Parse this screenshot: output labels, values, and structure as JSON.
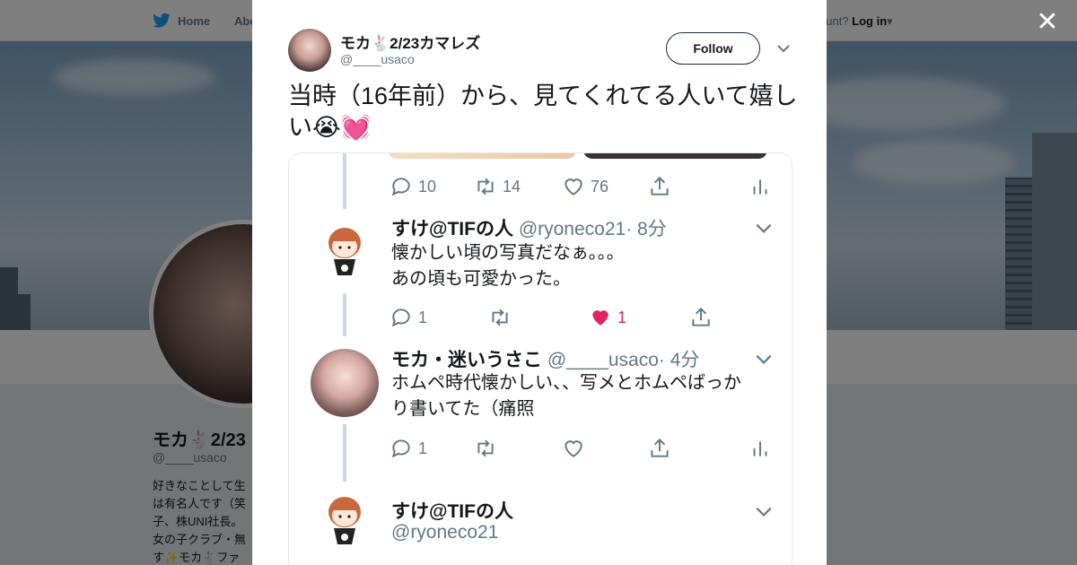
{
  "colors": {
    "twitter_blue": "#1da1f2",
    "like_red": "#e0245e",
    "gray": "#657786",
    "text": "#14171a"
  },
  "background_page": {
    "nav": {
      "home_label": "Home",
      "about_label": "Abo",
      "login_prefix": "ccount?",
      "login_label": "Log in"
    },
    "profile_name": "モカ🐇2/23",
    "profile_handle": "@____usaco",
    "bio_lines": [
      "好きなことして生",
      "は有名人です（笑",
      "子、株UNI社長。",
      "女の子クラブ・無",
      "す✨モカ🐇ファ"
    ]
  },
  "modal": {
    "author_name": "モカ🐇2/23カマレズ",
    "author_handle": "@____usaco",
    "follow_label": "Follow",
    "tweet_text": "当時（16年前）から、見てくれてる人いて嬉しい😭💓",
    "card": {
      "top_actions": {
        "reply": "10",
        "retweet": "14",
        "like": "76"
      },
      "replies": [
        {
          "name": "すけ@TIFの人",
          "handle": "@ryoneco21",
          "time": "· 8分",
          "lines": [
            "懐かしい頃の写真だなぁ。。。",
            "あの頃も可愛かった。"
          ],
          "reply": "1",
          "like": "1",
          "liked": true
        },
        {
          "name": "モカ・迷いうさこ",
          "handle": "@____usaco",
          "time": "· 4分",
          "lines": [
            "ホムペ時代懐かしい、、写メとホムペばっか",
            "り書いてた（痛照"
          ],
          "reply": "1"
        },
        {
          "name": "すけ@TIFの人",
          "handle": "@ryoneco21"
        }
      ]
    }
  },
  "close_label": "✕"
}
